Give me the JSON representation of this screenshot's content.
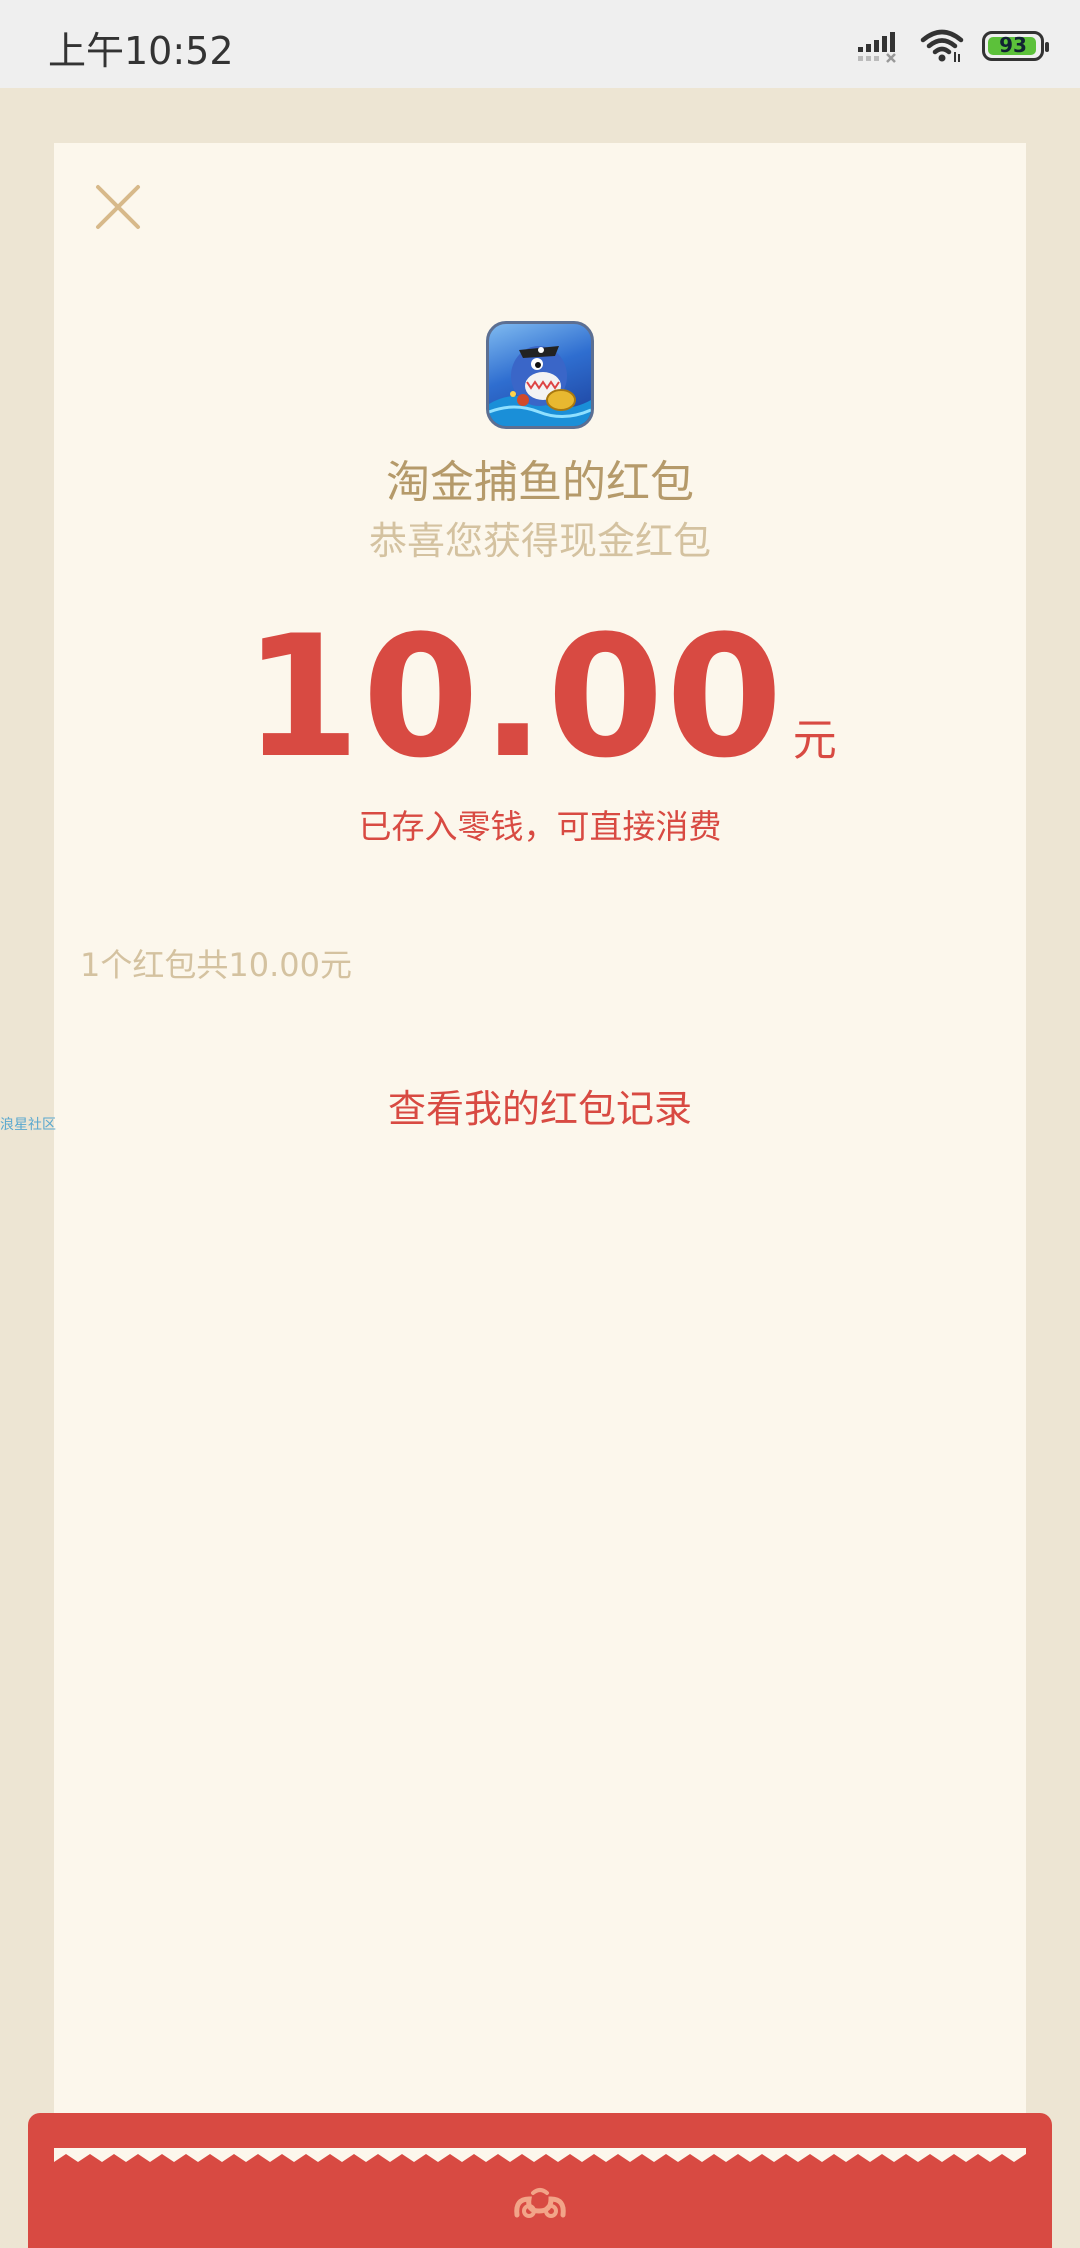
{
  "status_bar": {
    "time": "上午10:52",
    "battery": "93"
  },
  "app": {
    "icon": "fish-game-app-icon",
    "sender": "淘金捕鱼的红包",
    "greeting": "恭喜您获得现金红包"
  },
  "amount": {
    "value": "10.00",
    "unit": "元",
    "note": "已存入零钱，可直接消费"
  },
  "summary": "1个红包共10.00元",
  "record_link": "查看我的红包记录",
  "watermark": "浪星社区",
  "colors": {
    "background": "#ede5d3",
    "card": "#fcf7ec",
    "red": "#d84a42",
    "gold": "#b59a6a",
    "muted_gold": "#d4c2a0"
  }
}
